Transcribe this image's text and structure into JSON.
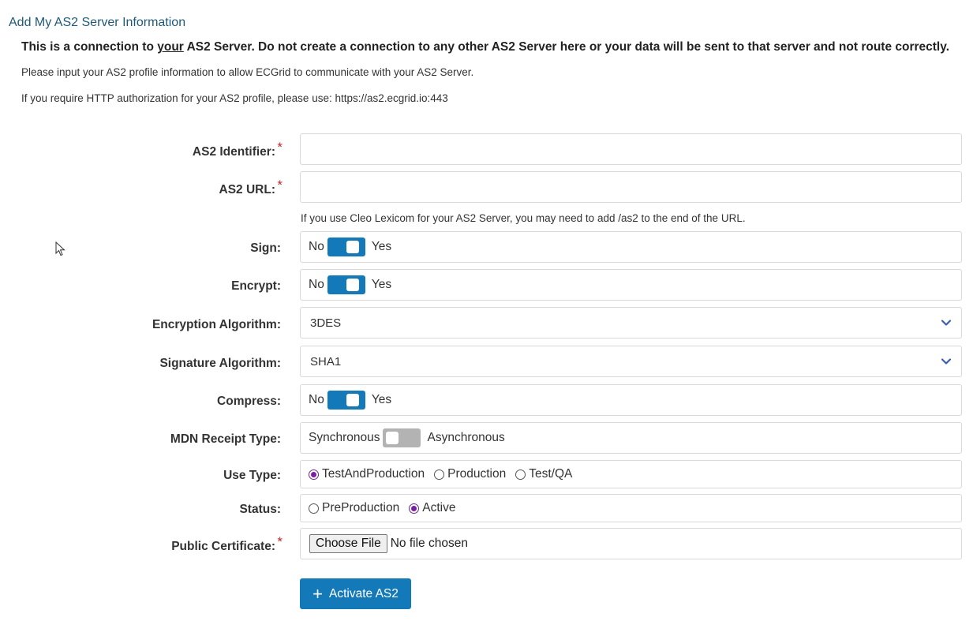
{
  "header": {
    "title": "Add My AS2 Server Information",
    "warning_pre": "This is a connection to ",
    "warning_underlined": "your",
    "warning_post": " AS2 Server. Do not create a connection to any other AS2 Server here or your data will be sent to that server and not route correctly.",
    "info1": "Please input your AS2 profile information to allow ECGrid to communicate with your AS2 Server.",
    "info2": "If you require HTTP authorization for your AS2 profile, please use: https://as2.ecgrid.io:443"
  },
  "form": {
    "as2_identifier": {
      "label": "AS2 Identifier:",
      "required": "*",
      "value": ""
    },
    "as2_url": {
      "label": "AS2 URL:",
      "required": "*",
      "value": "",
      "hint": "If you use Cleo Lexicom for your AS2 Server, you may need to add /as2 to the end of the URL."
    },
    "sign": {
      "label": "Sign:",
      "off_text": "No",
      "on_text": "Yes",
      "state": "Yes"
    },
    "encrypt": {
      "label": "Encrypt:",
      "off_text": "No",
      "on_text": "Yes",
      "state": "Yes"
    },
    "encryption_algorithm": {
      "label": "Encryption Algorithm:",
      "value": "3DES"
    },
    "signature_algorithm": {
      "label": "Signature Algorithm:",
      "value": "SHA1"
    },
    "compress": {
      "label": "Compress:",
      "off_text": "No",
      "on_text": "Yes",
      "state": "Yes"
    },
    "mdn_receipt_type": {
      "label": "MDN Receipt Type:",
      "off_text": "Synchronous",
      "on_text": "Asynchronous",
      "state": "Synchronous"
    },
    "use_type": {
      "label": "Use Type:",
      "options": [
        "TestAndProduction",
        "Production",
        "Test/QA"
      ],
      "selected": "TestAndProduction"
    },
    "status": {
      "label": "Status:",
      "options": [
        "PreProduction",
        "Active"
      ],
      "selected": "Active"
    },
    "public_certificate": {
      "label": "Public Certificate:",
      "required": "*",
      "button": "Choose File",
      "file_status": "No file chosen"
    },
    "submit": {
      "label": "Activate AS2",
      "icon": "plus-icon"
    }
  },
  "colors": {
    "accent": "#1479b8",
    "title": "#1d5a7a",
    "required": "#c0262c",
    "radio_selected": "#7b1fa2",
    "toggle_off": "#b3b3b3"
  }
}
